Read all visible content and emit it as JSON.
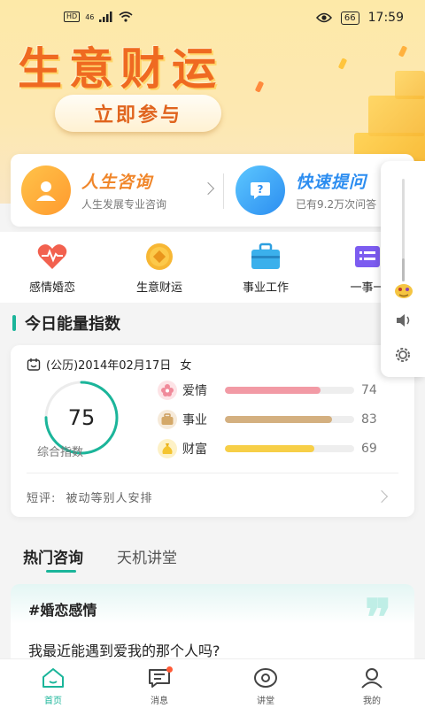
{
  "status_bar": {
    "hd": "HD",
    "network": "46",
    "battery": "66",
    "time": "17:59"
  },
  "banner": {
    "title": "生意财运",
    "cta": "立即参与"
  },
  "consult": {
    "left": {
      "title": "人生咨询",
      "subtitle": "人生发展专业咨询"
    },
    "right": {
      "title": "快速提问",
      "subtitle": "已有9.2万次问答"
    }
  },
  "categories": [
    {
      "label": "感情婚恋",
      "icon": "heart-pulse-icon"
    },
    {
      "label": "生意财运",
      "icon": "coin-icon"
    },
    {
      "label": "事业工作",
      "icon": "briefcase-icon"
    },
    {
      "label": "一事一",
      "icon": "list-icon"
    }
  ],
  "energy": {
    "section_title": "今日能量指数",
    "date": "(公历)2014年02月17日",
    "gender": "女",
    "score": "75",
    "score_fraction": 0.75,
    "score_label": "综合指数",
    "stats": [
      {
        "label": "爱情",
        "value": 74,
        "color": "#f29aa5"
      },
      {
        "label": "事业",
        "value": 83,
        "color": "#d4b080"
      },
      {
        "label": "财富",
        "value": 69,
        "color": "#f7cf47"
      }
    ],
    "comment_label": "短评:",
    "comment": "被动等别人安排"
  },
  "tabs": {
    "hot": "热门咨询",
    "lecture": "天机讲堂"
  },
  "hot_card": {
    "tag": "#婚恋感情",
    "question": "我最近能遇到爱我的那个人吗?"
  },
  "bottom_nav": [
    {
      "label": "首页",
      "icon": "home-icon"
    },
    {
      "label": "消息",
      "icon": "message-icon"
    },
    {
      "label": "讲堂",
      "icon": "lecture-icon"
    },
    {
      "label": "我的",
      "icon": "profile-icon"
    }
  ],
  "colors": {
    "accent": "#1bb59a",
    "banner_title": "#ef6a21"
  }
}
